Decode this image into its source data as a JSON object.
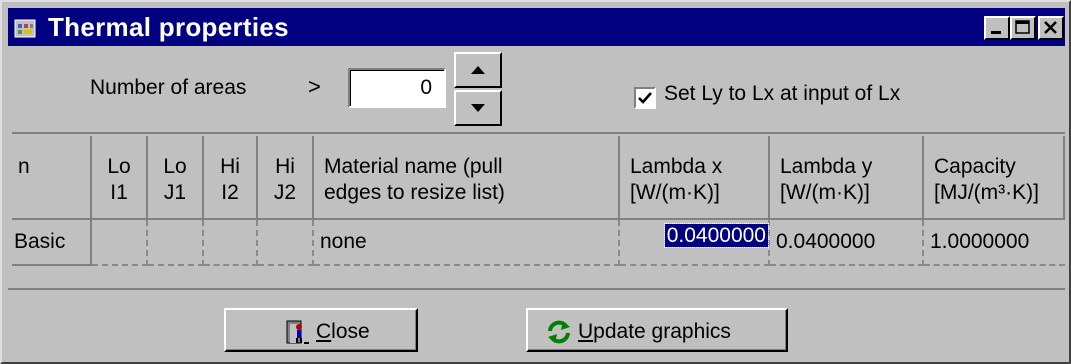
{
  "window": {
    "title": "Thermal properties",
    "controls": [
      "minimize-icon",
      "maximize-icon",
      "close-icon"
    ]
  },
  "areas": {
    "label": "Number of areas",
    "arrow": ">",
    "value": "0",
    "spin_icons": [
      "spin-up-icon",
      "spin-down-icon"
    ]
  },
  "option": {
    "checked": true,
    "label": "Set Ly to Lx at input of Lx"
  },
  "table": {
    "headers": [
      "n",
      "Lo\nI1",
      "Lo\nJ1",
      "Hi\nI2",
      "Hi\nJ2",
      "Material name (pull\nedges to resize list)",
      "Lambda x\n[W/(m·K)]",
      "Lambda y\n[W/(m·K)]",
      "Capacity\n[MJ/(m³·K)]"
    ],
    "rows": [
      [
        "Basic",
        "",
        "",
        "",
        "",
        "none",
        "0.0400000",
        "0.0400000",
        "1.0000000"
      ]
    ],
    "selected_cell": "0.0400000"
  },
  "buttons": {
    "close_underline": "C",
    "close_rest": "lose",
    "update_underline": "U",
    "update_rest": "pdate graphics"
  },
  "colors": {
    "titlebar": "#000080",
    "face": "#c0c0c0",
    "selection": "#000080"
  }
}
